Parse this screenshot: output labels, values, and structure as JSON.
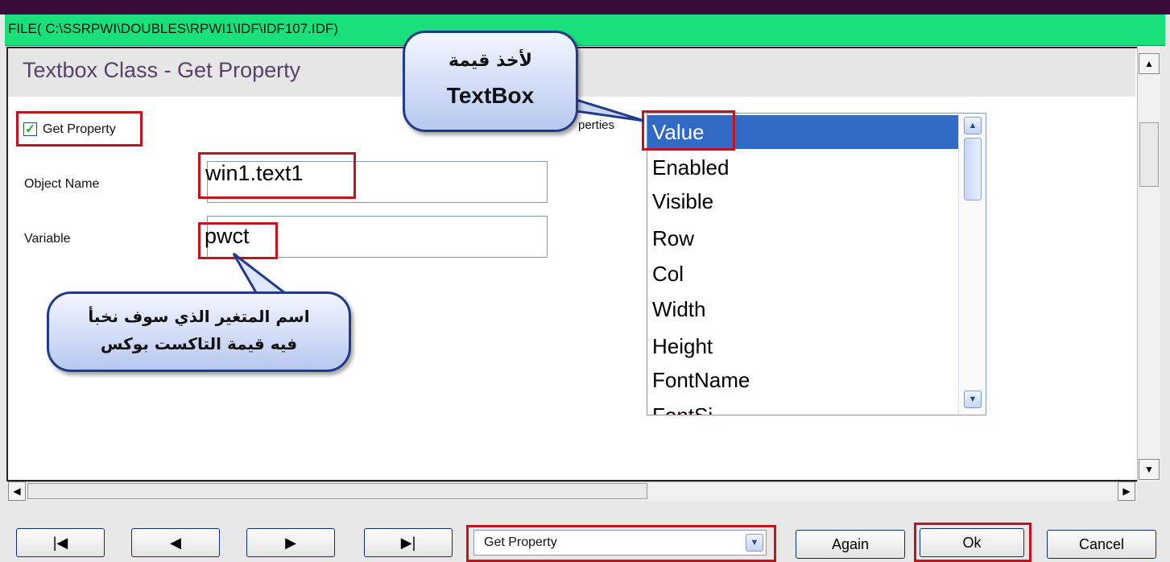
{
  "window": {
    "file_path": "FILE( C:\\SSRPWI\\DOUBLES\\RPWI1\\IDF\\IDF107.IDF)",
    "title": "Textbox Class - Get Property"
  },
  "form": {
    "get_property_checkbox_label": "Get Property",
    "get_property_checked": true,
    "object_name_label": "Object Name",
    "object_name_value": "win1.text1",
    "variable_label": "Variable",
    "variable_value": "pwct",
    "properties_label": "perties"
  },
  "properties_list": {
    "items": [
      "Value",
      "Enabled",
      "Visible",
      "Row",
      "Col",
      "Width",
      "Height",
      "FontName",
      "FontSi"
    ],
    "selected": "Value"
  },
  "annotations": {
    "top_bubble_line1": "لأخذ قيمة",
    "top_bubble_line2": "TextBox",
    "bottom_bubble_line1": "اسم المتغير الذي سوف نخبأ",
    "bottom_bubble_line2": "فيه قيمة التاكست بوكس"
  },
  "toolbar": {
    "first_icon": "first-record-icon",
    "prev_icon": "previous-record-icon",
    "next_icon": "next-record-icon",
    "last_icon": "last-record-icon",
    "mode_select_value": "Get Property",
    "again_label": "Again",
    "ok_label": "Ok",
    "cancel_label": "Cancel"
  },
  "colors": {
    "file_bar": "#19e07a",
    "selection": "#316ac5",
    "highlight_box": "#c0141e",
    "title_text": "#5a3f6a"
  }
}
